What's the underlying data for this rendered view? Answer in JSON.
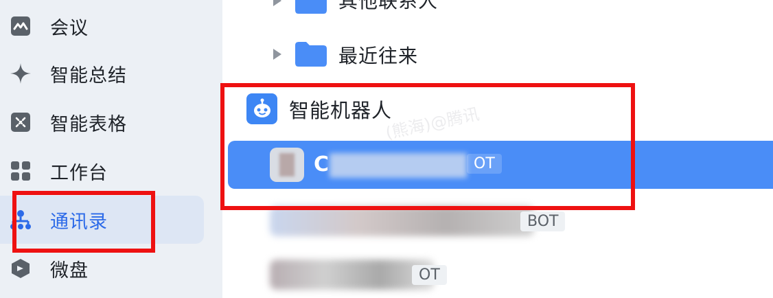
{
  "sidebar": {
    "items": [
      {
        "label": "会议",
        "icon": "meeting-icon"
      },
      {
        "label": "智能总结",
        "icon": "sparkle-icon"
      },
      {
        "label": "智能表格",
        "icon": "smart-table-icon"
      },
      {
        "label": "工作台",
        "icon": "grid-icon"
      },
      {
        "label": "通讯录",
        "icon": "contacts-icon",
        "active": true
      },
      {
        "label": "微盘",
        "icon": "drive-icon"
      }
    ]
  },
  "tree": {
    "folders": [
      {
        "label": "其他联系人",
        "icon": "folder-icon"
      },
      {
        "label": "最近往来",
        "icon": "folder-icon"
      }
    ],
    "section": {
      "label": "智能机器人",
      "icon": "robot-icon"
    },
    "bots": [
      {
        "name_visible": "C",
        "tag": "OT",
        "selected": true
      },
      {
        "name_visible": "",
        "tag": "BOT",
        "selected": false
      },
      {
        "name_visible": "",
        "tag": "OT",
        "selected": false
      }
    ]
  },
  "watermark": "(熊海)@腾讯",
  "colors": {
    "accent": "#2c6ae8",
    "selected_row": "#4a8df7",
    "highlight": "#ee1111",
    "sidebar_bg": "#ecf0f5"
  }
}
